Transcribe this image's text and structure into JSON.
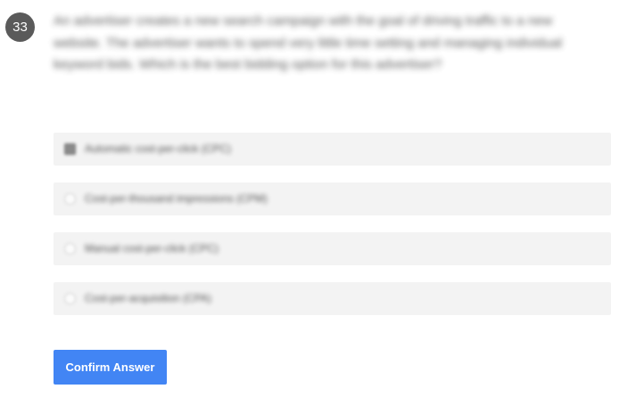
{
  "question": {
    "number": "33",
    "text": "An advertiser creates a new search campaign with the goal of driving traffic to a new website. The advertiser wants to spend very little time setting and managing individual keyword bids. Which is the best bidding option for this advertiser?"
  },
  "options": [
    {
      "label": "Automatic cost-per-click (CPC)",
      "selected": true
    },
    {
      "label": "Cost-per-thousand impressions (CPM)",
      "selected": false
    },
    {
      "label": "Manual cost-per-click (CPC)",
      "selected": false
    },
    {
      "label": "Cost-per-acquisition (CPA)",
      "selected": false
    }
  ],
  "confirm_button": {
    "label": "Confirm Answer"
  },
  "colors": {
    "accent": "#4285f4",
    "badge": "#5a5a5a",
    "option_background": "#f3f3f3"
  }
}
